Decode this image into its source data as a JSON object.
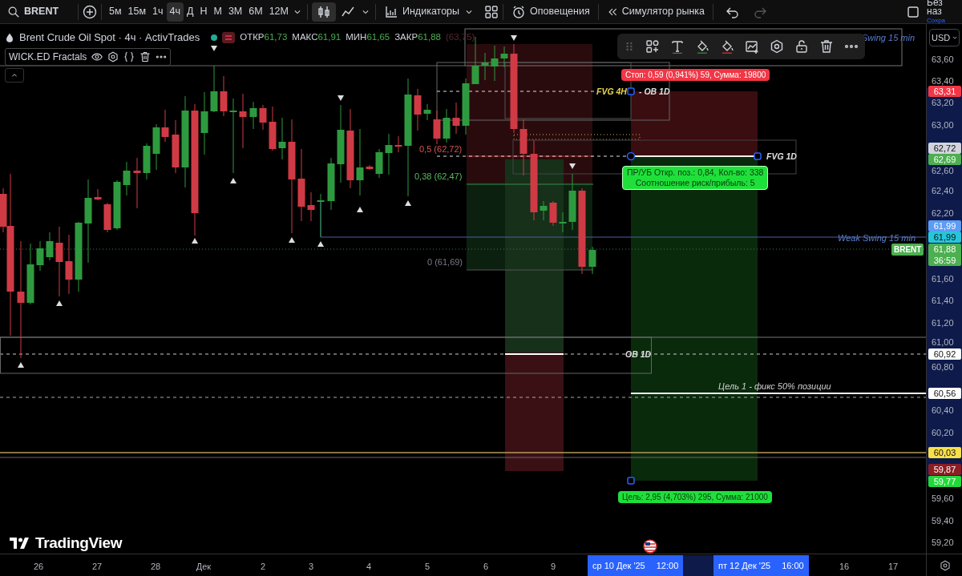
{
  "toolbar": {
    "symbol": "BRENT",
    "intervals": [
      {
        "label": "5м",
        "selected": false
      },
      {
        "label": "15м",
        "selected": false
      },
      {
        "label": "1ч",
        "selected": false
      },
      {
        "label": "4ч",
        "selected": true
      },
      {
        "label": "Д",
        "selected": false
      },
      {
        "label": "Н",
        "selected": false
      },
      {
        "label": "М",
        "selected": false
      },
      {
        "label": "3М",
        "selected": false
      },
      {
        "label": "6М",
        "selected": false
      },
      {
        "label": "12М",
        "selected": false
      }
    ],
    "chart_styles": [
      {
        "kind": "candles",
        "selected": true
      },
      {
        "kind": "line",
        "selected": false
      }
    ],
    "indicators": "Индикаторы",
    "alerts": "Оповещения",
    "replay": "Симулятор рынка",
    "layout_name": "Без наз",
    "save_status": "Сохра"
  },
  "legend": {
    "title": "Brent Crude Oil Spot · 4ч · ActivTrades",
    "ohlc": [
      {
        "label": "ОТКР",
        "value": "61,73"
      },
      {
        "label": "МАКС",
        "value": "61,91"
      },
      {
        "label": "МИН",
        "value": "61,65"
      },
      {
        "label": "ЗАКР",
        "value": "61,88"
      }
    ],
    "extra": "(63,75)"
  },
  "indicator": {
    "name": "WICK.ED Fractals"
  },
  "chart_labels": [
    {
      "kind": "fib",
      "text": "0,5 (62,72)",
      "color": "#d9534f"
    },
    {
      "kind": "fib",
      "text": "0,38 (62,47)",
      "color": "#5cb85c"
    },
    {
      "kind": "fib",
      "text": "0 (61,69)",
      "color": "#787b86"
    },
    {
      "kind": "zone",
      "text": "FVG 4H",
      "color": "#e8d44d"
    },
    {
      "kind": "zone",
      "text": "- OB 1D",
      "color": "#e0e0e0"
    },
    {
      "kind": "zone",
      "text": "FVG 1D",
      "color": "#e0e0e0"
    },
    {
      "kind": "zone",
      "text": "OB 1D",
      "color": "#e0e0e0"
    },
    {
      "kind": "note",
      "text": "Цель 1 - фикс 50% позиции",
      "color": "#d0d0d0"
    },
    {
      "kind": "swing",
      "text": "Swing 15 min",
      "color": "#5b7fd0"
    },
    {
      "kind": "swing",
      "text": "Weak Swing 15 min",
      "color": "#5b7fd0"
    }
  ],
  "position": {
    "stop": "Стоп: 0,59 (0,941%) 59, Сумма: 19800",
    "stats": [
      "ПР/УБ Откр. поз.: 0,84, Кол-во: 338",
      "Соотношение риск/прибыль: 5"
    ],
    "target": "Цель: 2,95 (4,703%) 295, Сумма: 21000"
  },
  "symbol_tag": "BRENT",
  "price_axis": {
    "currency": "USD",
    "ticks": [
      "63,60",
      "63,40",
      "63,20",
      "63,00",
      "62,60",
      "62,40",
      "62,20",
      "61,60",
      "61,40",
      "61,20",
      "61,00",
      "60,80",
      "60,40",
      "60,20",
      "59,60",
      "59,40",
      "59,20"
    ],
    "badges": [
      {
        "text": "63,31",
        "color": "#f23645"
      },
      {
        "text": "62,72",
        "color": "#d1d4dc"
      },
      {
        "text": "62,69",
        "color": "#4caf50"
      },
      {
        "text": "61,99",
        "color": "#5b9cf6"
      },
      {
        "text": "61,99",
        "color": "#26c6da"
      },
      {
        "text": "61,88",
        "countdown": "36:59",
        "color": "#4caf50"
      },
      {
        "text": "60,92",
        "color": "#ffffff"
      },
      {
        "text": "60,56",
        "color": "#ffffff"
      },
      {
        "text": "60,03",
        "color": "#f7e04b"
      },
      {
        "text": "59,87",
        "color": "#8b1e24"
      },
      {
        "text": "59,77",
        "color": "#22d93a"
      }
    ]
  },
  "time_axis": {
    "ticks": [
      "26",
      "27",
      "28",
      "Дек",
      "2",
      "3",
      "4",
      "5",
      "6",
      "9",
      "16",
      "17"
    ],
    "range": [
      {
        "date": "ср 10 Дек '25",
        "time": "12:00"
      },
      {
        "date": "пт 12 Дек '25",
        "time": "16:00"
      }
    ]
  },
  "brand": "TradingView"
}
